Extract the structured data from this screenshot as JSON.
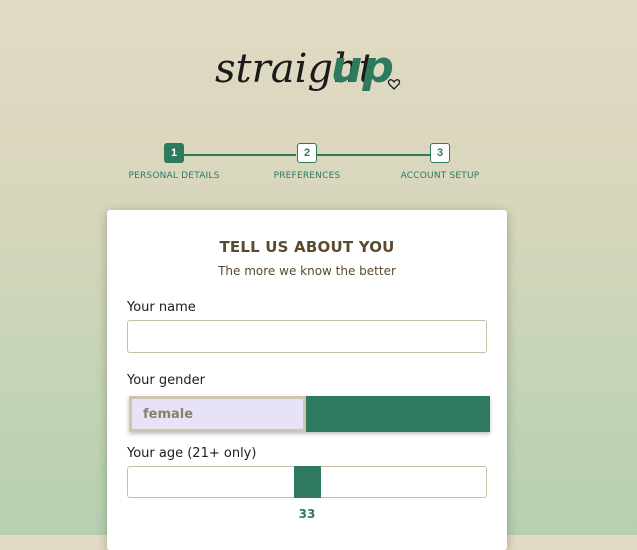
{
  "logo": {
    "text_part1": "straight",
    "text_part2": "up"
  },
  "steps": [
    {
      "number": "1",
      "label": "PERSONAL DETAILS",
      "active": true
    },
    {
      "number": "2",
      "label": "PREFERENCES",
      "active": false
    },
    {
      "number": "3",
      "label": "ACCOUNT SETUP",
      "active": false
    }
  ],
  "card": {
    "title": "TELL US ABOUT YOU",
    "subtitle": "The more we know the better"
  },
  "form": {
    "name_label": "Your name",
    "name_value": "",
    "gender_label": "Your gender",
    "gender_option_female": "female",
    "gender_option_male": "",
    "age_label": "Your age (21+ only)",
    "age_value": "33",
    "age_percent": 0.46
  },
  "colors": {
    "accent": "#2e7a5e",
    "heading": "#5b4a2e",
    "female_bg": "#e7e2f5"
  }
}
